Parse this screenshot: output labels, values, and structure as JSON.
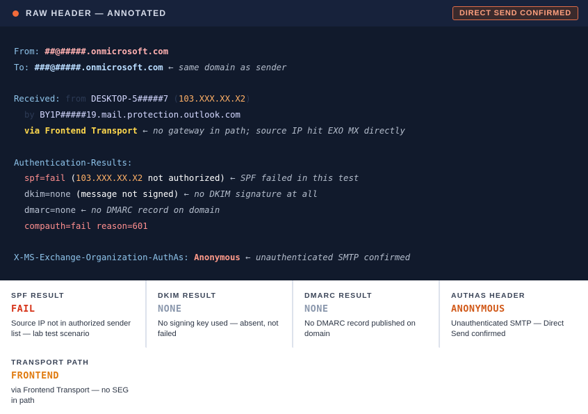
{
  "header": {
    "title": "RAW HEADER — ANNOTATED",
    "badge": "DIRECT SEND CONFIRMED"
  },
  "raw": {
    "from_label": "From: ",
    "from_value": "##@#####.onmicrosoft.com",
    "to_label": "To: ",
    "to_value": "###@#####.onmicrosoft.com",
    "to_note": " ← same domain as sender",
    "received_label": "Received: ",
    "received_from": "from ",
    "received_host": "DESKTOP-5#####7 ",
    "received_paren_open": "(",
    "received_ip": "103.XXX.XX.X2",
    "received_paren_close": ")",
    "by_kw": "by ",
    "by_host": "BY1P#####19.mail.protection.outlook.com",
    "via_value": "via Frontend Transport",
    "via_note": " ← no gateway in path; source IP hit EXO MX directly",
    "auth_label": "Authentication-Results:",
    "spf_value": "spf=fail",
    "spf_paren_open": " (",
    "spf_ip": "103.XXX.XX.X2",
    "spf_rest": " not authorized)",
    "spf_note": " ← SPF failed in this test",
    "dkim_value": "dkim=none",
    "dkim_rest": " (message not signed)",
    "dkim_note": " ← no DKIM signature at all",
    "dmarc_value": "dmarc=none",
    "dmarc_note": " ← no DMARC record on domain",
    "compauth_value": "compauth=fail reason=601",
    "authas_label": "X-MS-Exchange-Organization-AuthAs: ",
    "authas_value": "Anonymous",
    "authas_note": " ← unauthenticated SMTP confirmed"
  },
  "cards": [
    {
      "label": "SPF RESULT",
      "value": "FAIL",
      "desc": "Source IP not in authorized sender list — lab test scenario"
    },
    {
      "label": "DKIM RESULT",
      "value": "NONE",
      "desc": "No signing key used — absent, not failed"
    },
    {
      "label": "DMARC RESULT",
      "value": "NONE",
      "desc": "No DMARC record published on domain"
    },
    {
      "label": "AUTHAS HEADER",
      "value": "ANONYMOUS",
      "desc": "Unauthenticated SMTP — Direct Send confirmed"
    },
    {
      "label": "TRANSPORT PATH",
      "value": "FRONTEND",
      "desc": "via Frontend Transport — no SEG in path"
    }
  ],
  "colors": {
    "fail": "#d63318",
    "none": "#8b98ad",
    "anonymous": "#d15a1a",
    "frontend": "#e07b10",
    "status_dot": "#f26b3a"
  }
}
